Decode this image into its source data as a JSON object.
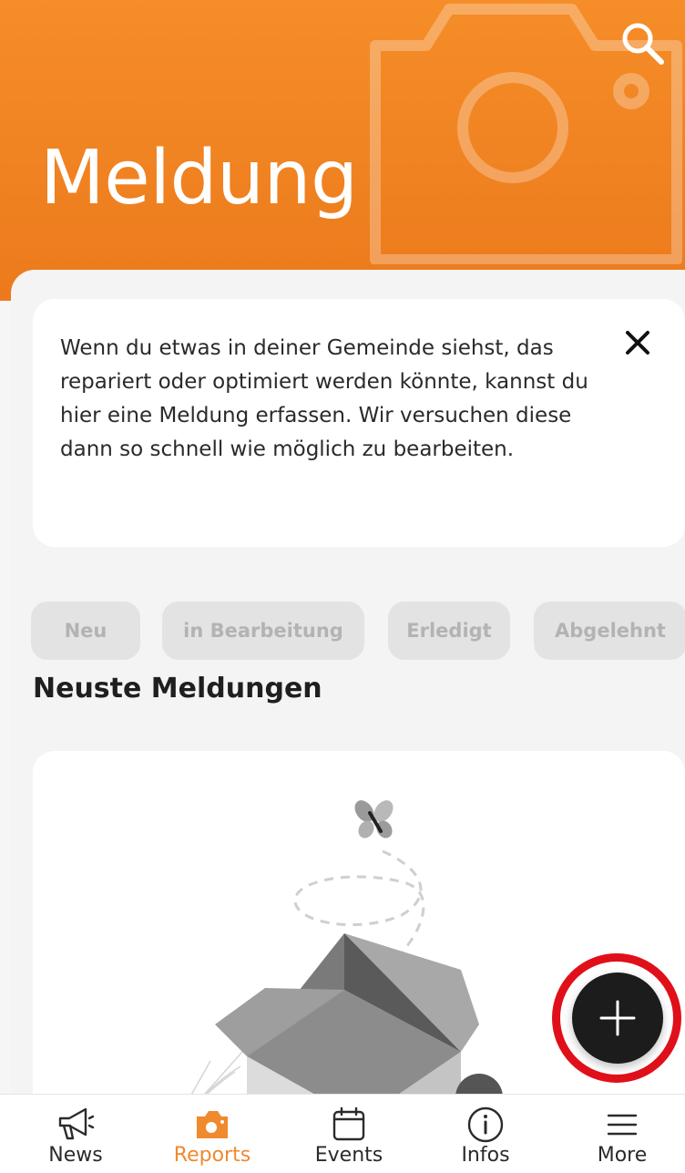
{
  "header": {
    "title": "Meldung",
    "color": "#f28424"
  },
  "info_card": {
    "text": "Wenn du etwas in deiner Gemeinde siehst, das repariert oder optimiert werden könnte, kannst du hier eine Meldung erfassen. Wir versuchen diese dann so schnell wie möglich zu bearbeiten."
  },
  "filters": [
    {
      "label": "Neu"
    },
    {
      "label": "in Bearbeitung"
    },
    {
      "label": "Erledigt"
    },
    {
      "label": "Abgelehnt"
    }
  ],
  "section": {
    "title": "Neuste Meldungen"
  },
  "fab": {
    "icon": "plus-icon",
    "highlight_color": "#e0101a"
  },
  "nav": {
    "active_color": "#ef8a2e",
    "items": [
      {
        "label": "News",
        "icon": "megaphone-icon"
      },
      {
        "label": "Reports",
        "icon": "camera-icon"
      },
      {
        "label": "Events",
        "icon": "calendar-icon"
      },
      {
        "label": "Infos",
        "icon": "info-icon"
      },
      {
        "label": "More",
        "icon": "menu-icon"
      }
    ]
  }
}
